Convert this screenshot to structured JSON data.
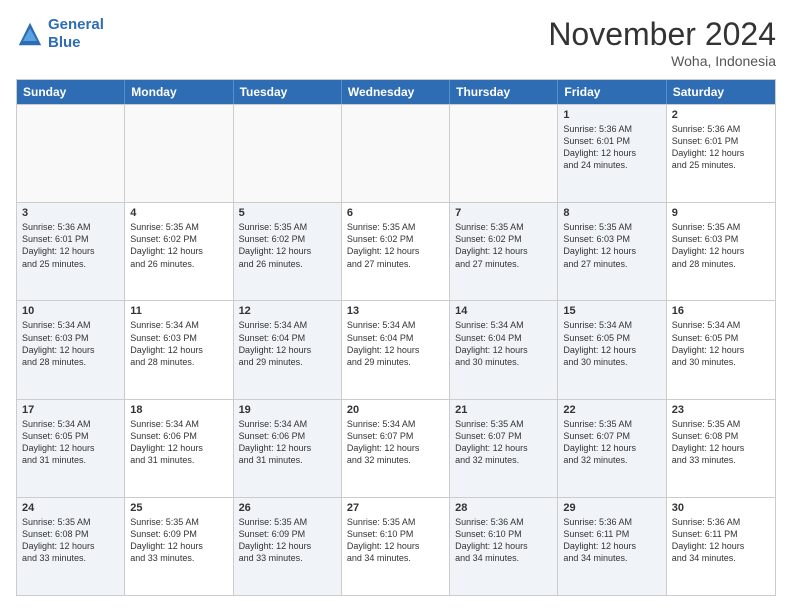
{
  "header": {
    "logo_line1": "General",
    "logo_line2": "Blue",
    "month": "November 2024",
    "location": "Woha, Indonesia"
  },
  "weekdays": [
    "Sunday",
    "Monday",
    "Tuesday",
    "Wednesday",
    "Thursday",
    "Friday",
    "Saturday"
  ],
  "rows": [
    [
      {
        "day": "",
        "info": "",
        "empty": true
      },
      {
        "day": "",
        "info": "",
        "empty": true
      },
      {
        "day": "",
        "info": "",
        "empty": true
      },
      {
        "day": "",
        "info": "",
        "empty": true
      },
      {
        "day": "",
        "info": "",
        "empty": true
      },
      {
        "day": "1",
        "info": "Sunrise: 5:36 AM\nSunset: 6:01 PM\nDaylight: 12 hours\nand 24 minutes.",
        "shaded": true
      },
      {
        "day": "2",
        "info": "Sunrise: 5:36 AM\nSunset: 6:01 PM\nDaylight: 12 hours\nand 25 minutes.",
        "shaded": false
      }
    ],
    [
      {
        "day": "3",
        "info": "Sunrise: 5:36 AM\nSunset: 6:01 PM\nDaylight: 12 hours\nand 25 minutes.",
        "shaded": true
      },
      {
        "day": "4",
        "info": "Sunrise: 5:35 AM\nSunset: 6:02 PM\nDaylight: 12 hours\nand 26 minutes."
      },
      {
        "day": "5",
        "info": "Sunrise: 5:35 AM\nSunset: 6:02 PM\nDaylight: 12 hours\nand 26 minutes.",
        "shaded": true
      },
      {
        "day": "6",
        "info": "Sunrise: 5:35 AM\nSunset: 6:02 PM\nDaylight: 12 hours\nand 27 minutes."
      },
      {
        "day": "7",
        "info": "Sunrise: 5:35 AM\nSunset: 6:02 PM\nDaylight: 12 hours\nand 27 minutes.",
        "shaded": true
      },
      {
        "day": "8",
        "info": "Sunrise: 5:35 AM\nSunset: 6:03 PM\nDaylight: 12 hours\nand 27 minutes.",
        "shaded": true
      },
      {
        "day": "9",
        "info": "Sunrise: 5:35 AM\nSunset: 6:03 PM\nDaylight: 12 hours\nand 28 minutes."
      }
    ],
    [
      {
        "day": "10",
        "info": "Sunrise: 5:34 AM\nSunset: 6:03 PM\nDaylight: 12 hours\nand 28 minutes.",
        "shaded": true
      },
      {
        "day": "11",
        "info": "Sunrise: 5:34 AM\nSunset: 6:03 PM\nDaylight: 12 hours\nand 28 minutes."
      },
      {
        "day": "12",
        "info": "Sunrise: 5:34 AM\nSunset: 6:04 PM\nDaylight: 12 hours\nand 29 minutes.",
        "shaded": true
      },
      {
        "day": "13",
        "info": "Sunrise: 5:34 AM\nSunset: 6:04 PM\nDaylight: 12 hours\nand 29 minutes."
      },
      {
        "day": "14",
        "info": "Sunrise: 5:34 AM\nSunset: 6:04 PM\nDaylight: 12 hours\nand 30 minutes.",
        "shaded": true
      },
      {
        "day": "15",
        "info": "Sunrise: 5:34 AM\nSunset: 6:05 PM\nDaylight: 12 hours\nand 30 minutes.",
        "shaded": true
      },
      {
        "day": "16",
        "info": "Sunrise: 5:34 AM\nSunset: 6:05 PM\nDaylight: 12 hours\nand 30 minutes."
      }
    ],
    [
      {
        "day": "17",
        "info": "Sunrise: 5:34 AM\nSunset: 6:05 PM\nDaylight: 12 hours\nand 31 minutes.",
        "shaded": true
      },
      {
        "day": "18",
        "info": "Sunrise: 5:34 AM\nSunset: 6:06 PM\nDaylight: 12 hours\nand 31 minutes."
      },
      {
        "day": "19",
        "info": "Sunrise: 5:34 AM\nSunset: 6:06 PM\nDaylight: 12 hours\nand 31 minutes.",
        "shaded": true
      },
      {
        "day": "20",
        "info": "Sunrise: 5:34 AM\nSunset: 6:07 PM\nDaylight: 12 hours\nand 32 minutes."
      },
      {
        "day": "21",
        "info": "Sunrise: 5:35 AM\nSunset: 6:07 PM\nDaylight: 12 hours\nand 32 minutes.",
        "shaded": true
      },
      {
        "day": "22",
        "info": "Sunrise: 5:35 AM\nSunset: 6:07 PM\nDaylight: 12 hours\nand 32 minutes.",
        "shaded": true
      },
      {
        "day": "23",
        "info": "Sunrise: 5:35 AM\nSunset: 6:08 PM\nDaylight: 12 hours\nand 33 minutes."
      }
    ],
    [
      {
        "day": "24",
        "info": "Sunrise: 5:35 AM\nSunset: 6:08 PM\nDaylight: 12 hours\nand 33 minutes.",
        "shaded": true
      },
      {
        "day": "25",
        "info": "Sunrise: 5:35 AM\nSunset: 6:09 PM\nDaylight: 12 hours\nand 33 minutes."
      },
      {
        "day": "26",
        "info": "Sunrise: 5:35 AM\nSunset: 6:09 PM\nDaylight: 12 hours\nand 33 minutes.",
        "shaded": true
      },
      {
        "day": "27",
        "info": "Sunrise: 5:35 AM\nSunset: 6:10 PM\nDaylight: 12 hours\nand 34 minutes."
      },
      {
        "day": "28",
        "info": "Sunrise: 5:36 AM\nSunset: 6:10 PM\nDaylight: 12 hours\nand 34 minutes.",
        "shaded": true
      },
      {
        "day": "29",
        "info": "Sunrise: 5:36 AM\nSunset: 6:11 PM\nDaylight: 12 hours\nand 34 minutes.",
        "shaded": true
      },
      {
        "day": "30",
        "info": "Sunrise: 5:36 AM\nSunset: 6:11 PM\nDaylight: 12 hours\nand 34 minutes."
      }
    ]
  ]
}
